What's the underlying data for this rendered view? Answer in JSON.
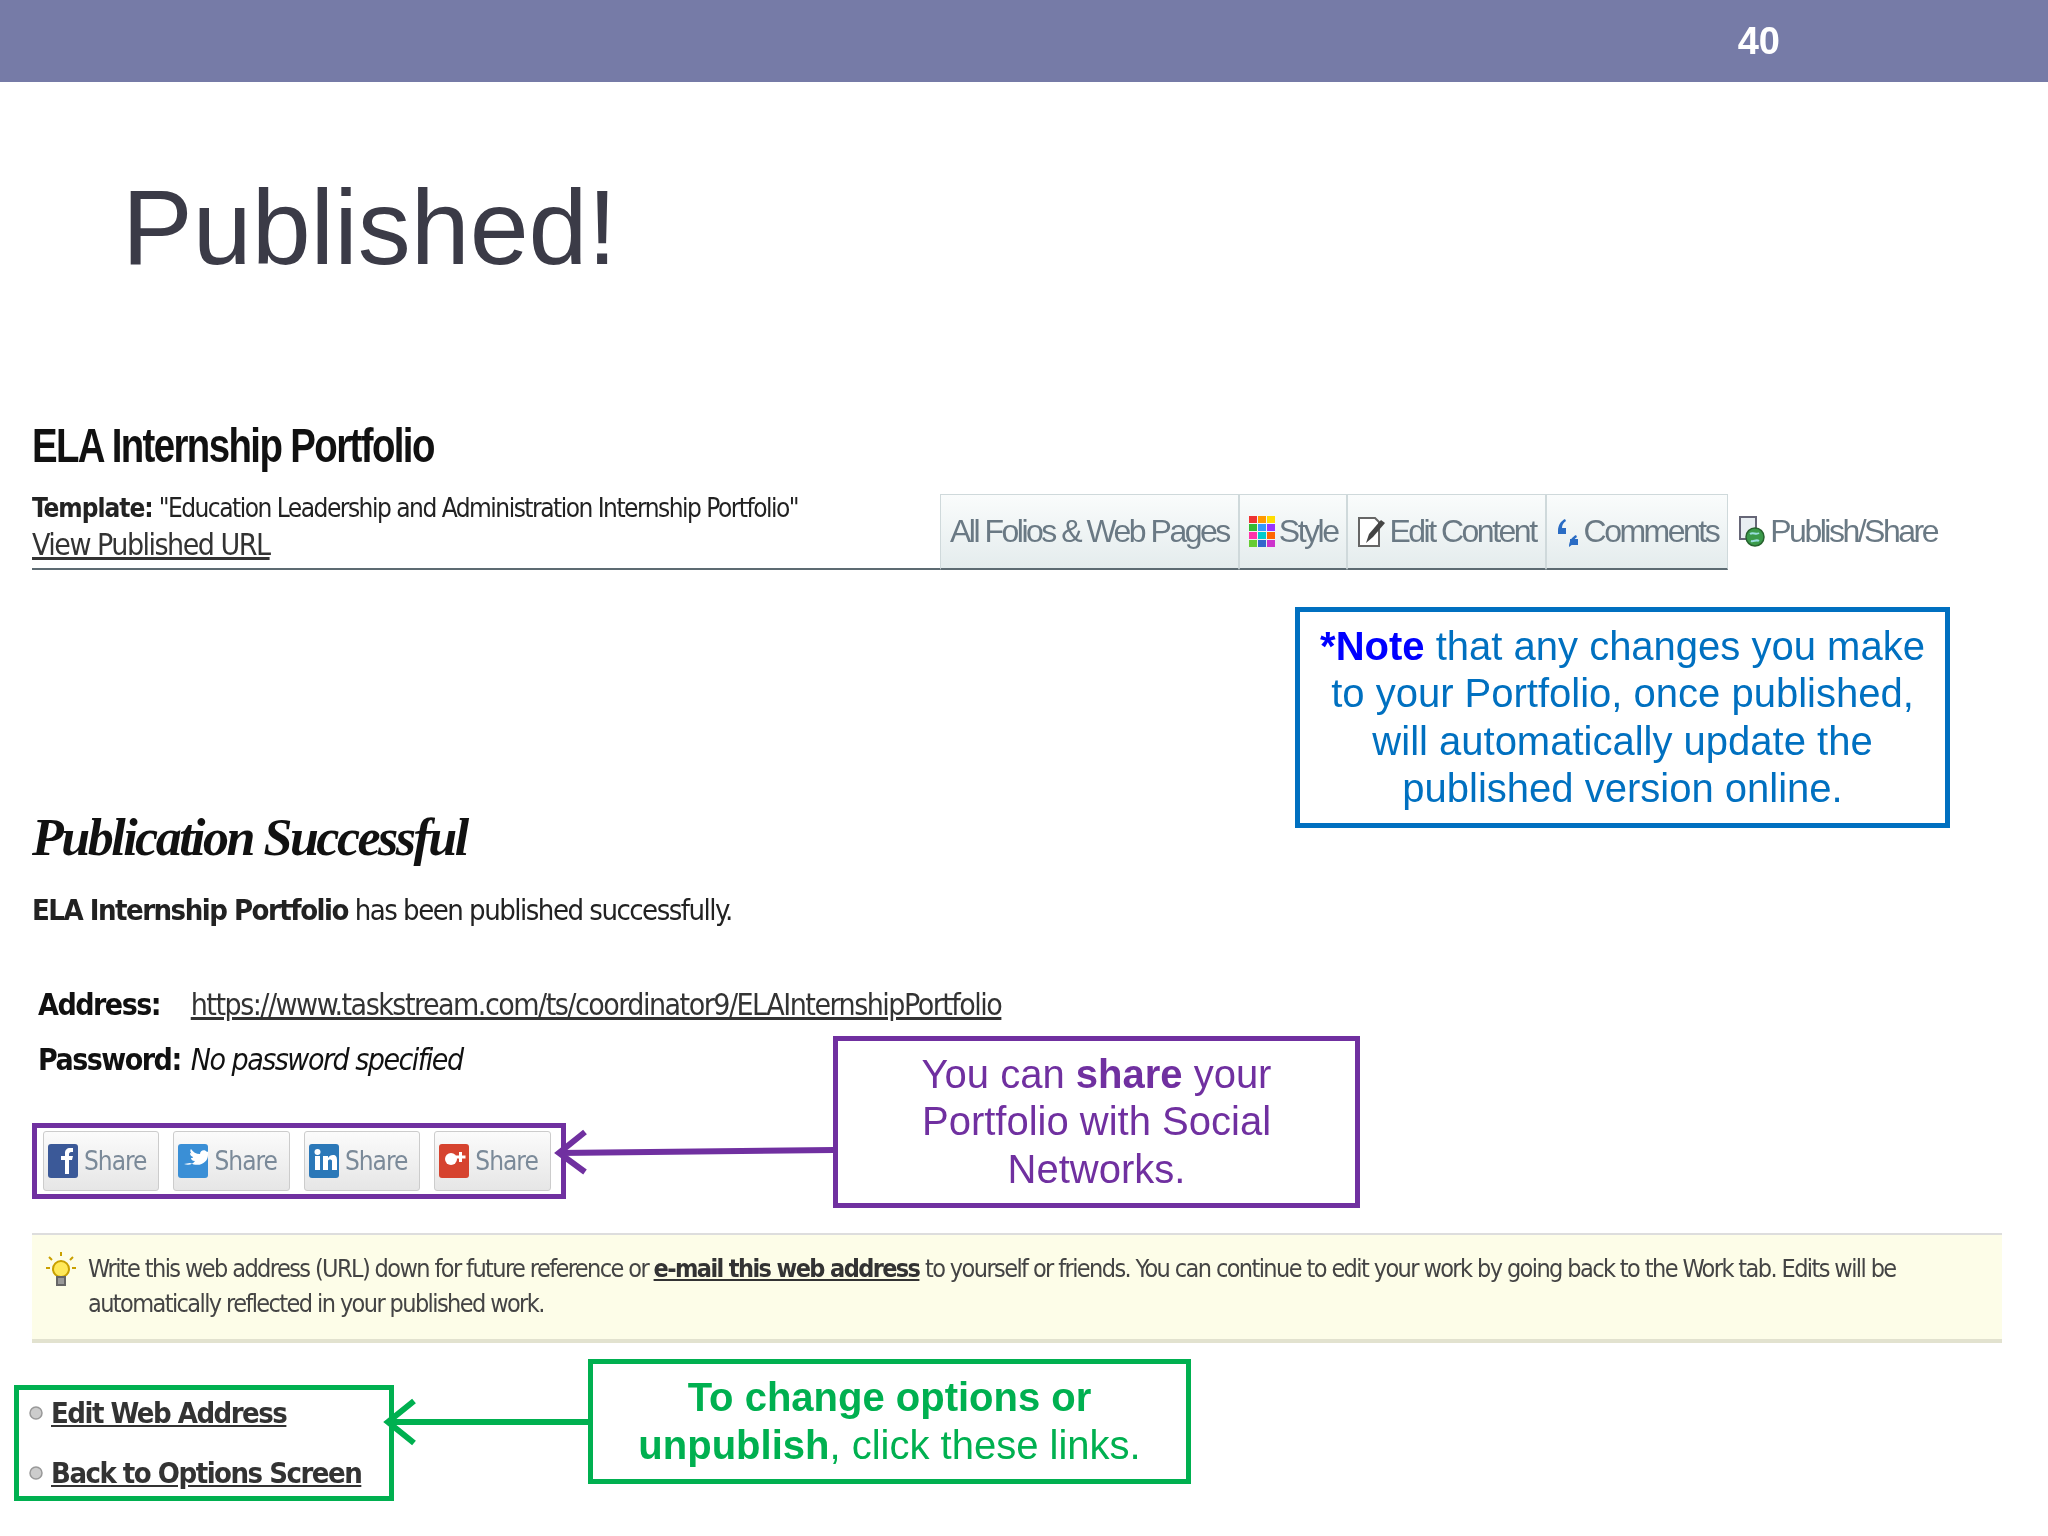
{
  "slide": {
    "number": "40",
    "title": "Published!"
  },
  "portfolio": {
    "title": "ELA Internship Portfolio",
    "template_label": "Template:",
    "template_value": "\"Education Leadership and Administration Internship Portfolio\"",
    "view_link": "View Published URL"
  },
  "tabs": [
    {
      "label": "All Folios & Web Pages",
      "kind": "plain",
      "selected": false
    },
    {
      "label": "Style",
      "kind": "palette",
      "selected": false
    },
    {
      "label": "Edit Content",
      "kind": "edit",
      "selected": false
    },
    {
      "label": "Comments",
      "kind": "quote",
      "selected": false
    },
    {
      "label": "Publish/Share",
      "kind": "publish",
      "selected": true
    }
  ],
  "publication": {
    "heading": "Publication Successful",
    "message": "**ELA Internship Portfolio** has been published successfully.",
    "address_label": "Address:",
    "address": "https://www.taskstream.com/ts/coordinator9/ELAInternshipPortfolio",
    "password_label": "Password:",
    "password": "No password specified"
  },
  "share_buttons": [
    {
      "kind": "facebook",
      "label": "Share"
    },
    {
      "kind": "twitter",
      "label": "Share"
    },
    {
      "kind": "linkedin",
      "label": "Share"
    },
    {
      "kind": "googleplus",
      "label": "Share"
    }
  ],
  "tip": {
    "before": "Write this web address (URL) down for future reference or ",
    "link": "e-mail this web address",
    "after": " to yourself or friends. You can continue to edit your work by going back to the Work tab. Edits will be automatically reflected in your published work."
  },
  "links": [
    {
      "label": "Edit Web Address"
    },
    {
      "label": "Back to Options Screen"
    }
  ],
  "callouts": [
    {
      "kind": "note",
      "lead": "*Note",
      "text": "that any changes you make to your Portfolio, once published, will automatically update the published version online."
    },
    {
      "kind": "share",
      "text": "You can **share** your Portfolio with Social Networks."
    },
    {
      "kind": "links",
      "text": "**To change options or unpublish**, click these links."
    }
  ]
}
